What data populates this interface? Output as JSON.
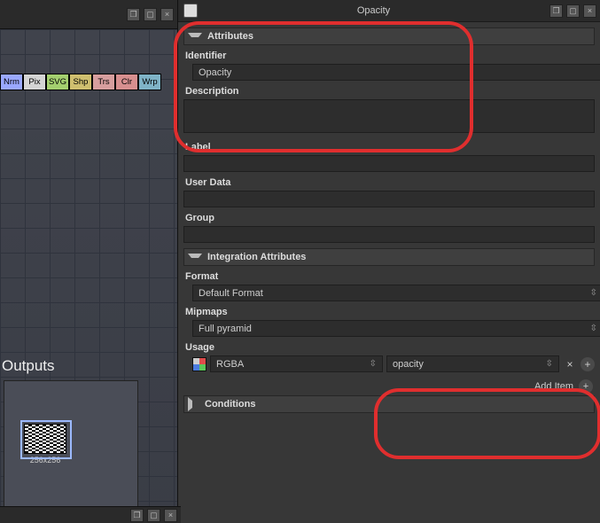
{
  "glyphs": {
    "pop_out": "❐",
    "maximize": "▢",
    "close": "×",
    "updown": "⇳",
    "plus": "+"
  },
  "left": {
    "tool_chips": [
      "Nrm",
      "Pix",
      "SVG",
      "Shp",
      "Trs",
      "Clr",
      "Wrp"
    ],
    "outputs_label": "Outputs",
    "node_size": "256x256"
  },
  "panel": {
    "title": "Opacity"
  },
  "sections": {
    "attributes": {
      "header": "Attributes",
      "identifier_label": "Identifier",
      "identifier_value": "Opacity",
      "description_label": "Description",
      "description_value": "",
      "label_label": "Label",
      "label_value": "",
      "userdata_label": "User Data",
      "userdata_value": "",
      "group_label": "Group",
      "group_value": ""
    },
    "integration": {
      "header": "Integration Attributes",
      "format_label": "Format",
      "format_value": "Default Format",
      "mipmaps_label": "Mipmaps",
      "mipmaps_value": "Full pyramid",
      "usage_label": "Usage",
      "usage_left": "RGBA",
      "usage_right": "opacity",
      "add_item": "Add Item"
    },
    "conditions": {
      "header": "Conditions"
    }
  }
}
